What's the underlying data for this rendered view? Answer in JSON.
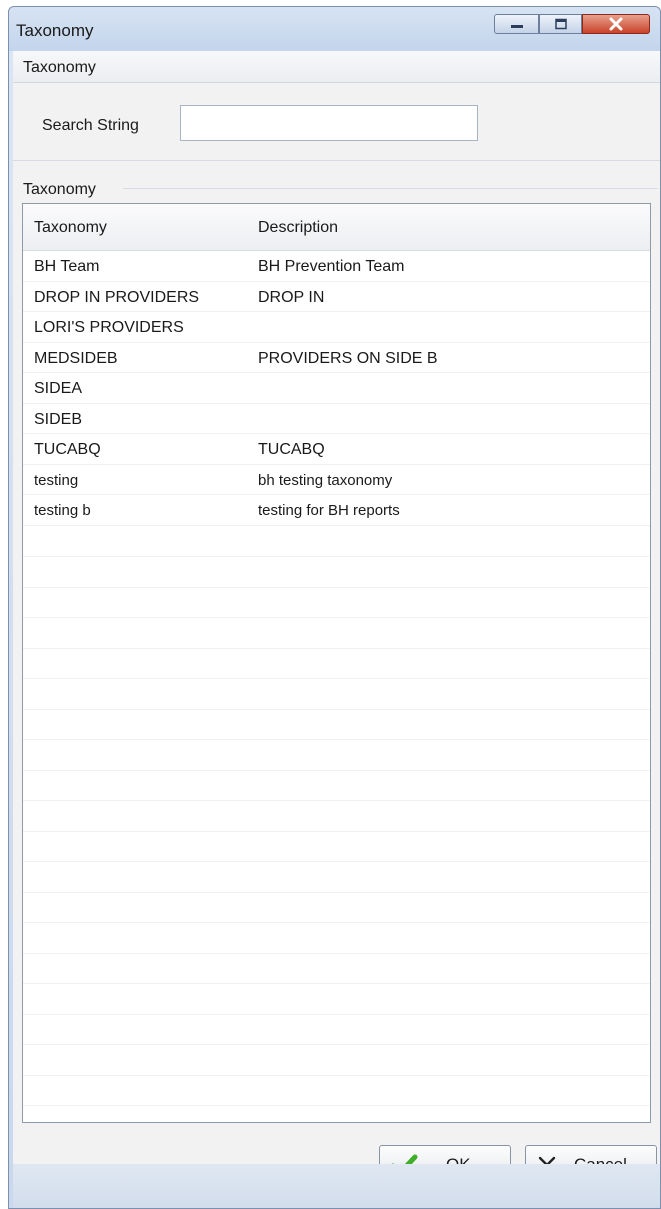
{
  "window": {
    "title": "Taxonomy",
    "buttons": [
      "minimize-icon",
      "maximize-icon",
      "close-icon"
    ]
  },
  "search_group": {
    "title": "Taxonomy",
    "search_label": "Search String",
    "search_value": ""
  },
  "list_group": {
    "title": "Taxonomy",
    "columns": [
      "Taxonomy",
      "Description"
    ],
    "rows": [
      {
        "taxonomy": "BH Team",
        "description": "BH Prevention Team"
      },
      {
        "taxonomy": "DROP IN PROVIDERS",
        "description": "DROP IN"
      },
      {
        "taxonomy": "LORI'S PROVIDERS",
        "description": ""
      },
      {
        "taxonomy": "MEDSIDEB",
        "description": "PROVIDERS ON SIDE B"
      },
      {
        "taxonomy": "SIDEA",
        "description": ""
      },
      {
        "taxonomy": "SIDEB",
        "description": ""
      },
      {
        "taxonomy": "TUCABQ",
        "description": "TUCABQ"
      },
      {
        "taxonomy": "testing",
        "description": "bh testing taxonomy"
      },
      {
        "taxonomy": "testing b",
        "description": "testing for BH reports"
      }
    ]
  },
  "footer": {
    "ok_label": "OK",
    "cancel_label": "Cancel",
    "ok_icon": "green-check-icon",
    "cancel_icon": "x-icon"
  }
}
